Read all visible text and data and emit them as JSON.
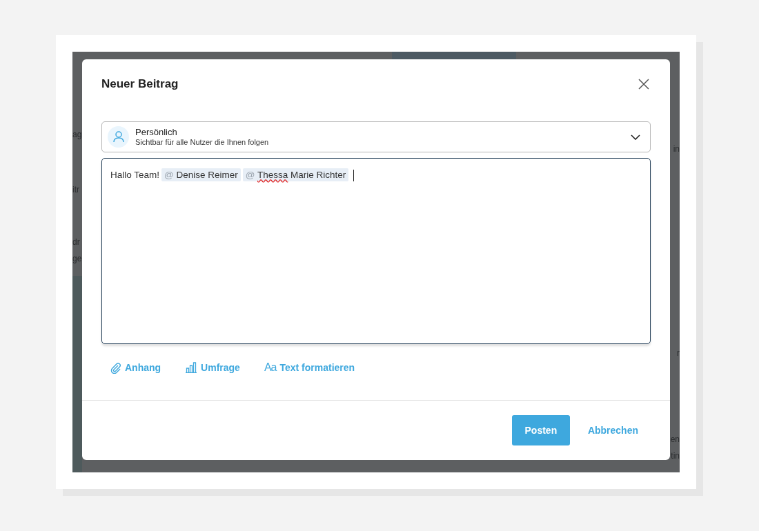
{
  "backdrop": {
    "left_fragments": [
      "ag",
      "itr",
      "dr",
      "ge"
    ],
    "right_fragments": [
      "in",
      "r",
      "en",
      "tin"
    ]
  },
  "modal": {
    "title": "Neuer Beitrag",
    "audience": {
      "label": "Persönlich",
      "description": "Sichtbar für alle Nutzer die Ihnen folgen"
    },
    "composer": {
      "text": "Hallo Team!",
      "mentions": [
        {
          "at": "@",
          "name": "Denise Reimer",
          "spelling_error": false
        },
        {
          "at": "@",
          "name": "Thessa Marie Richter",
          "spelling_error": true
        }
      ]
    },
    "tools": [
      {
        "kind": "attachment",
        "label": "Anhang"
      },
      {
        "kind": "poll",
        "label": "Umfrage"
      },
      {
        "kind": "format",
        "icon_text": "Aa",
        "label": "Text formatieren"
      }
    ],
    "buttons": [
      {
        "kind": "primary",
        "label": "Posten"
      },
      {
        "kind": "link",
        "label": "Abbrechen"
      }
    ]
  }
}
